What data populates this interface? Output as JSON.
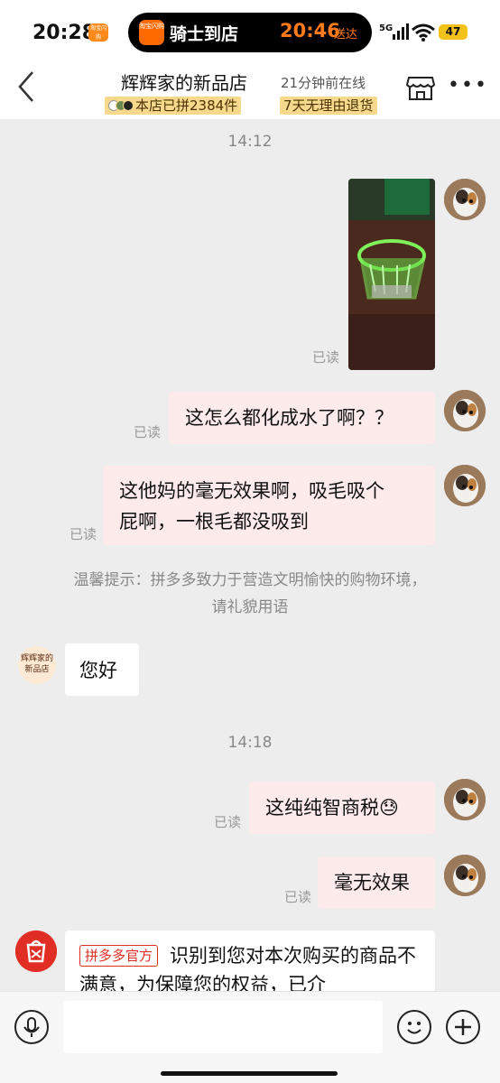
{
  "status_bar": {
    "time": "20:28",
    "app_mini_label": "淘宝闪购",
    "island_app_label": "淘宝闪购",
    "island_title": "骑士到店",
    "island_time": "20:46",
    "island_deliver": "送达",
    "network": "5G",
    "battery": "47"
  },
  "header": {
    "shop_name": "辉辉家的新品店",
    "online_status": "21分钟前在线",
    "badge_sold": "本店已拼2384件",
    "badge_return": "7天无理由退货"
  },
  "messages": {
    "time_1": "14:12",
    "read_label": "已读",
    "msg_1": "这怎么都化成水了啊？？",
    "msg_2_line1": "这他妈的毫无效果啊，吸毛吸个",
    "msg_2_line2": "屁啊，一根毛都没吸到",
    "tip_line1": "温馨提示：拼多多致力于营造文明愉快的购物环境，",
    "tip_line2": "请礼貌用语",
    "shop_avatar_text": "辉辉家的新品店",
    "reply_1": "您好",
    "time_2": "14:18",
    "msg_3": "这纯纯智商税😓",
    "msg_4": "毫无效果",
    "official_tag": "拼多多官方",
    "official_text": "识别到您对本次购买的商品不满意，为保障您的权益，已介"
  },
  "input": {
    "placeholder": ""
  },
  "colors": {
    "accent_red": "#e02e24",
    "bubble_pink": "#fdeaea",
    "badge_gold": "#f7d98e"
  }
}
